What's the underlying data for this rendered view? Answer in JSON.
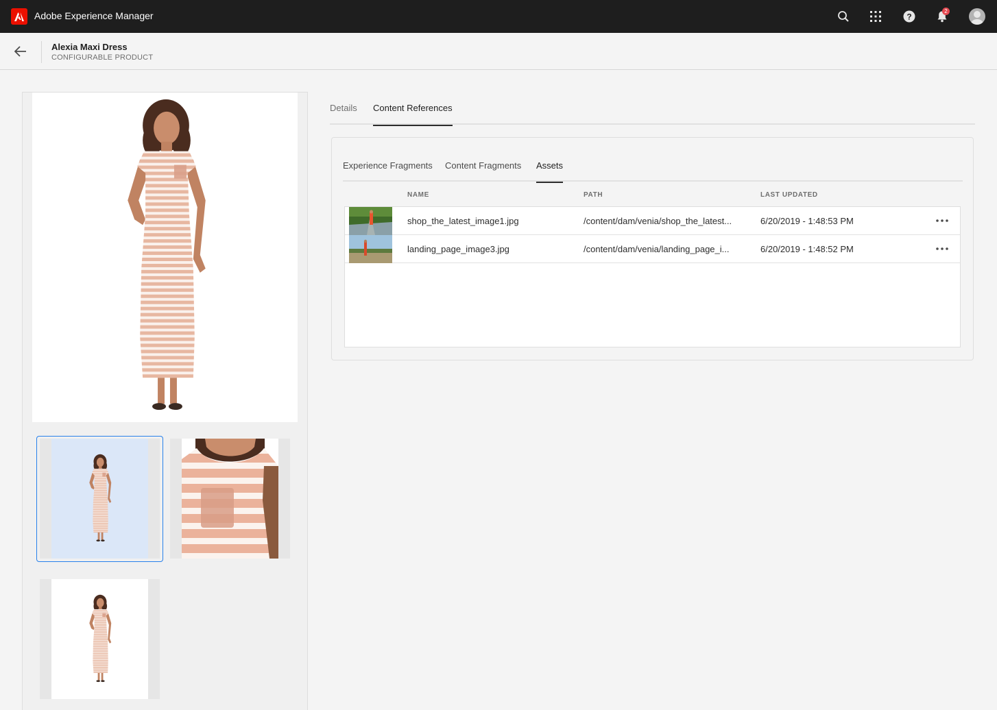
{
  "shell": {
    "app_title": "Adobe Experience Manager",
    "logo_icon": "adobe-logo-icon",
    "notification_count": "2",
    "brand_color": "#eb1000"
  },
  "header": {
    "title": "Alexia Maxi Dress",
    "subtitle": "CONFIGURABLE PRODUCT"
  },
  "tabs": [
    {
      "label": "Details",
      "active": false
    },
    {
      "label": "Content References",
      "active": true
    }
  ],
  "subtabs": [
    {
      "label": "Experience Fragments",
      "active": false
    },
    {
      "label": "Content Fragments",
      "active": false
    },
    {
      "label": "Assets",
      "active": true
    }
  ],
  "assets_table": {
    "columns": [
      "NAME",
      "PATH",
      "LAST UPDATED"
    ],
    "rows": [
      {
        "name": "shop_the_latest_image1.jpg",
        "path": "/content/dam/venia/shop_the_latest...",
        "updated": "6/20/2019 - 1:48:53 PM"
      },
      {
        "name": "landing_page_image3.jpg",
        "path": "/content/dam/venia/landing_page_i...",
        "updated": "6/20/2019 - 1:48:52 PM"
      }
    ]
  },
  "colors": {
    "shell_bg": "#1e1e1e",
    "accent_blue": "#2680eb",
    "dress_stripe": "#e8b8a2"
  }
}
